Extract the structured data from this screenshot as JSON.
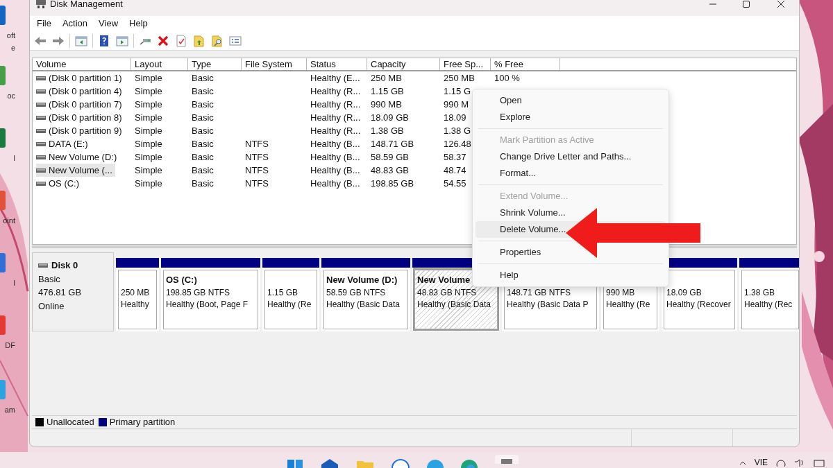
{
  "desktop_icons": [
    {
      "lines": [
        "oft",
        "e"
      ],
      "color": "#1565c0"
    },
    {
      "lines": [
        "oc"
      ],
      "color": "#43a047"
    },
    {
      "lines": [
        "l"
      ],
      "color": "#1b7a3e"
    },
    {
      "lines": [
        "oint"
      ],
      "color": "#e0533a"
    },
    {
      "lines": [
        "l"
      ],
      "color": "#2f6fd6"
    },
    {
      "lines": [
        "DF"
      ],
      "color": "#e53935"
    },
    {
      "lines": [
        "am"
      ],
      "color": "#2aa3e0"
    }
  ],
  "window": {
    "title": "Disk Management"
  },
  "menu_bar": [
    "File",
    "Action",
    "View",
    "Help"
  ],
  "volume_table": {
    "columns": [
      "Volume",
      "Layout",
      "Type",
      "File System",
      "Status",
      "Capacity",
      "Free Sp...",
      "% Free"
    ],
    "rows": [
      {
        "selected": false,
        "cells": [
          "(Disk 0 partition 1)",
          "Simple",
          "Basic",
          "",
          "Healthy (E...",
          "250 MB",
          "250 MB",
          "100 %"
        ]
      },
      {
        "selected": false,
        "cells": [
          "(Disk 0 partition 4)",
          "Simple",
          "Basic",
          "",
          "Healthy (R...",
          "1.15 GB",
          "1.15 G",
          ""
        ]
      },
      {
        "selected": false,
        "cells": [
          "(Disk 0 partition 7)",
          "Simple",
          "Basic",
          "",
          "Healthy (R...",
          "990 MB",
          "990 M",
          ""
        ]
      },
      {
        "selected": false,
        "cells": [
          "(Disk 0 partition 8)",
          "Simple",
          "Basic",
          "",
          "Healthy (R...",
          "18.09 GB",
          "18.09",
          ""
        ]
      },
      {
        "selected": false,
        "cells": [
          "(Disk 0 partition 9)",
          "Simple",
          "Basic",
          "",
          "Healthy (R...",
          "1.38 GB",
          "1.38 G",
          ""
        ]
      },
      {
        "selected": false,
        "cells": [
          "DATA (E:)",
          "Simple",
          "Basic",
          "NTFS",
          "Healthy (B...",
          "148.71 GB",
          "126.48",
          ""
        ]
      },
      {
        "selected": false,
        "cells": [
          "New Volume (D:)",
          "Simple",
          "Basic",
          "NTFS",
          "Healthy (B...",
          "58.59 GB",
          "58.37",
          ""
        ]
      },
      {
        "selected": true,
        "cells": [
          "New Volume (...",
          "Simple",
          "Basic",
          "NTFS",
          "Healthy (B...",
          "48.83 GB",
          "48.74",
          ""
        ]
      },
      {
        "selected": false,
        "cells": [
          "OS (C:)",
          "Simple",
          "Basic",
          "NTFS",
          "Healthy (B...",
          "198.85 GB",
          "54.55",
          ""
        ]
      }
    ]
  },
  "disks": [
    {
      "name": "Disk 0",
      "type": "Basic",
      "size": "476.81 GB",
      "status": "Online",
      "partitions": [
        {
          "size": "250 MB",
          "status": "Healthy",
          "selected": false
        },
        {
          "name": "OS  (C:)",
          "size": "198.85 GB NTFS",
          "status": "Healthy (Boot, Page F",
          "selected": false
        },
        {
          "size": "1.15 GB",
          "status": "Healthy (Re",
          "selected": false
        },
        {
          "name": "New Volume  (D:)",
          "size": "58.59 GB NTFS",
          "status": "Healthy (Basic Data",
          "selected": false
        },
        {
          "name": "New Volume",
          "size": "48.83 GB NTFS",
          "status": "Healthy (Basic Data",
          "selected": true
        },
        {
          "size": "148.71 GB NTFS",
          "status": "Healthy (Basic Data P",
          "selected": false
        },
        {
          "size": "990 MB",
          "status": "Healthy (Re",
          "selected": false
        },
        {
          "size": "18.09 GB",
          "status": "Healthy (Recover",
          "selected": false
        },
        {
          "size": "1.38 GB",
          "status": "Healthy (Rec",
          "selected": false
        }
      ]
    }
  ],
  "legend": [
    {
      "label": "Unallocated",
      "color": "#000000"
    },
    {
      "label": "Primary partition",
      "color": "#000080"
    }
  ],
  "context_menu": {
    "items": [
      {
        "kind": "item",
        "label": "Open",
        "disabled": false,
        "selected": false
      },
      {
        "kind": "item",
        "label": "Explore",
        "disabled": false,
        "selected": false
      },
      {
        "kind": "separator"
      },
      {
        "kind": "item",
        "label": "Mark Partition as Active",
        "disabled": true,
        "selected": false
      },
      {
        "kind": "item",
        "label": "Change Drive Letter and Paths...",
        "disabled": false,
        "selected": false
      },
      {
        "kind": "item",
        "label": "Format...",
        "disabled": false,
        "selected": false
      },
      {
        "kind": "separator"
      },
      {
        "kind": "item",
        "label": "Extend Volume...",
        "disabled": true,
        "selected": false
      },
      {
        "kind": "item",
        "label": "Shrink Volume...",
        "disabled": false,
        "selected": false
      },
      {
        "kind": "item",
        "label": "Delete Volume...",
        "disabled": false,
        "selected": true
      },
      {
        "kind": "separator"
      },
      {
        "kind": "item",
        "label": "Properties",
        "disabled": false,
        "selected": false
      },
      {
        "kind": "separator"
      },
      {
        "kind": "item",
        "label": "Help",
        "disabled": false,
        "selected": false
      }
    ]
  },
  "taskbar": {
    "language": "VIE"
  }
}
